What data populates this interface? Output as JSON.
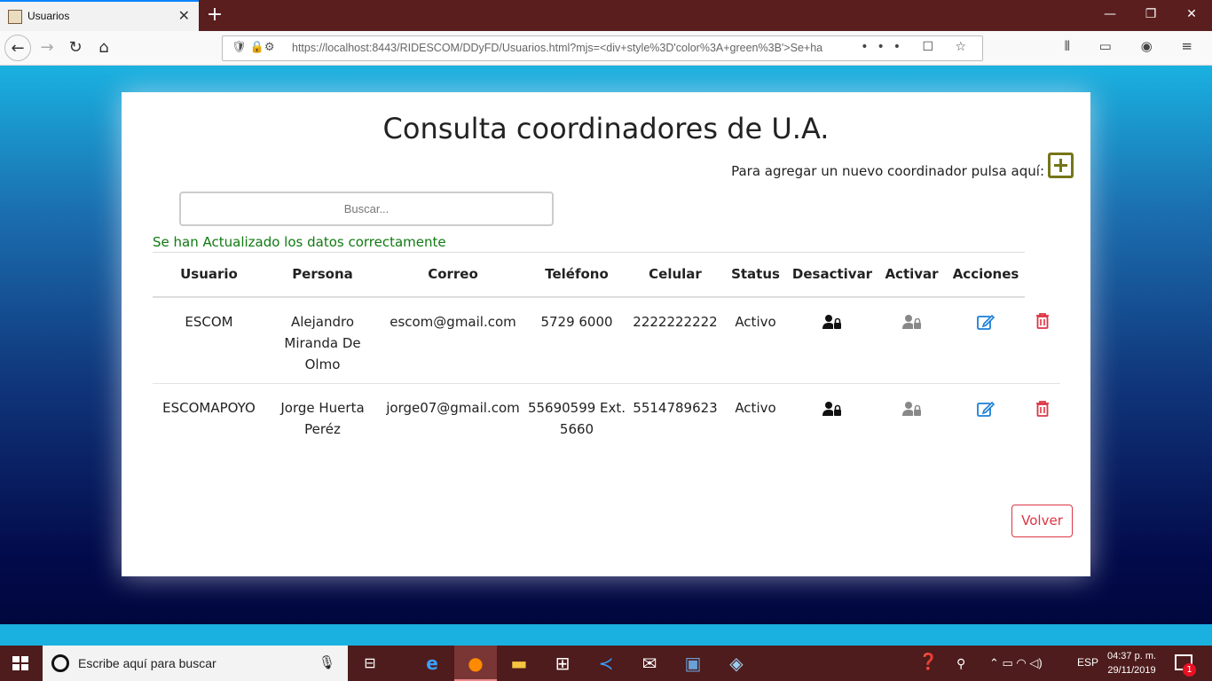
{
  "browser": {
    "tab_title": "Usuarios",
    "url": "https://localhost:8443/RIDESCOM/DDyFD/Usuarios.html?mjs=<div+style%3D'color%3A+green%3B'>Se+ha",
    "tab_close": "✕",
    "new_tab": "+",
    "url_actions": "••• ☐ ☆",
    "toolbar_icons": "⫴ ▭ ◉ ≡"
  },
  "page": {
    "title": "Consulta coordinadores de U.A.",
    "add_hint": "Para agregar un nuevo coordinador pulsa aquí:",
    "search_placeholder": "Buscar...",
    "success_message": "Se han Actualizado los datos correctamente",
    "back_button": "Volver"
  },
  "table": {
    "headers": [
      "Usuario",
      "Persona",
      "Correo",
      "Teléfono",
      "Celular",
      "Status",
      "Desactivar",
      "Activar",
      "Acciones"
    ],
    "rows": [
      {
        "usuario": "ESCOM",
        "persona": "Alejandro Miranda De Olmo",
        "correo": "escom@gmail.com",
        "telefono": "5729 6000",
        "celular": "2222222222",
        "status": "Activo"
      },
      {
        "usuario": "ESCOMAPOYO",
        "persona": "Jorge Huerta Peréz",
        "correo": "jorge07@gmail.com",
        "telefono": "55690599 Ext. 5660",
        "celular": "5514789623",
        "status": "Activo"
      }
    ]
  },
  "taskbar": {
    "search_placeholder": "Escribe aquí para buscar",
    "language": "ESP",
    "time": "04:37 p. m.",
    "date": "29/11/2019",
    "notification_count": "1"
  },
  "colors": {
    "add_button": "#757519",
    "edit_icon": "#1a7fd6",
    "delete_icon": "#dc3545",
    "success_text": "#107a10"
  },
  "icons": {
    "add": "plus-square-icon",
    "deactivate": "user-lock-icon",
    "activate": "user-lock-icon",
    "edit": "edit-icon",
    "delete": "trash-icon"
  }
}
